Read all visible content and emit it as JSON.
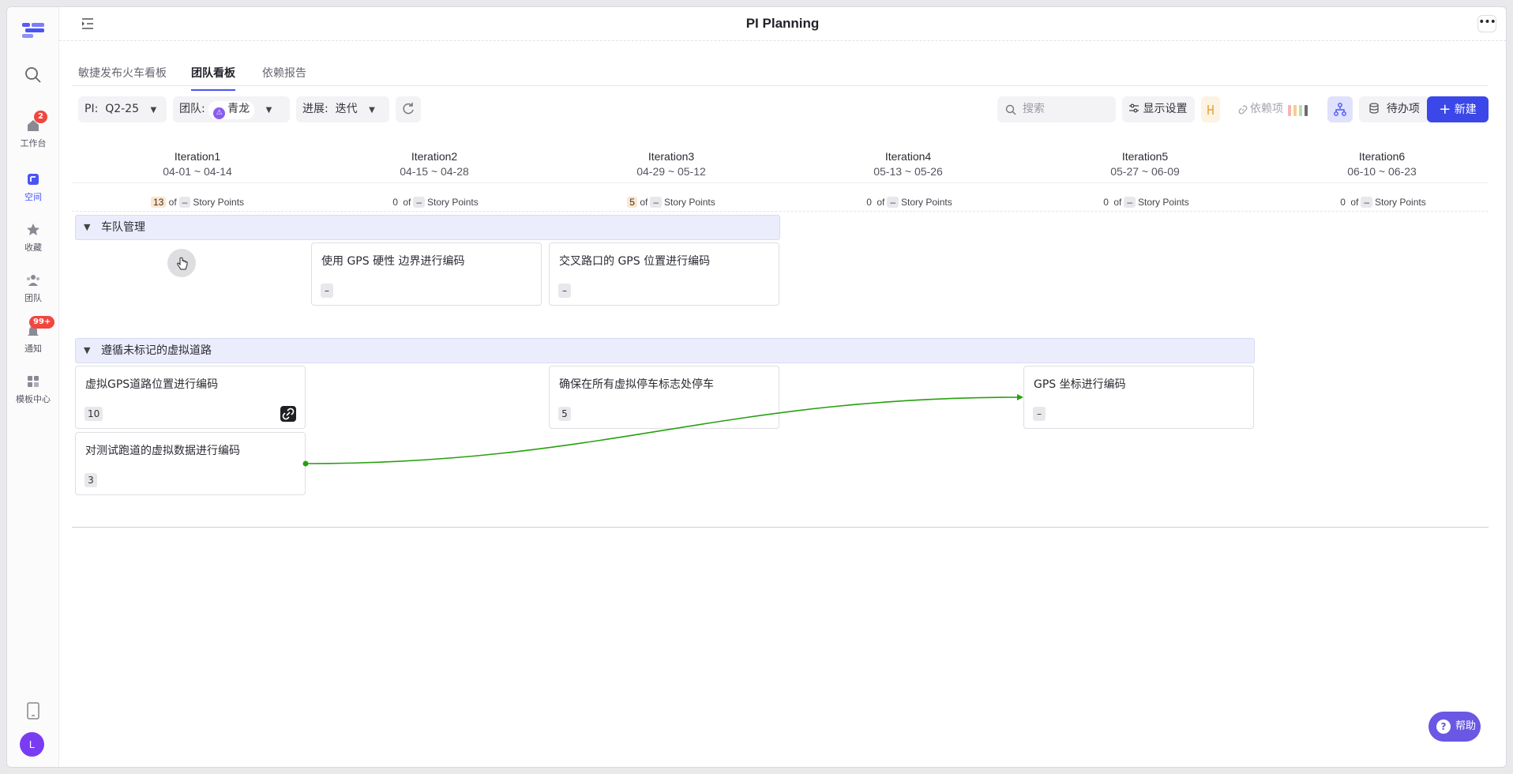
{
  "app": {
    "title": "PI Planning"
  },
  "sidebar": {
    "items": [
      {
        "label": "工作台",
        "badge": "2"
      },
      {
        "label": "空间"
      },
      {
        "label": "收藏"
      },
      {
        "label": "团队"
      },
      {
        "label": "通知",
        "badge": "99+"
      },
      {
        "label": "模板中心"
      }
    ],
    "avatar": "L"
  },
  "tabs": [
    "敏捷发布火车看板",
    "团队看板",
    "依赖报告"
  ],
  "toolbar": {
    "pi_label": "PI:",
    "pi_value": "Q2-25",
    "team_label": "团队:",
    "team_value": "青龙",
    "progress_label": "进展:",
    "progress_value": "迭代",
    "search_placeholder": "搜索",
    "display_settings": "显示设置",
    "dependencies": "依赖项",
    "backlog": "待办项",
    "new": "新建"
  },
  "iterations": [
    {
      "name": "Iteration1",
      "dates": "04-01 ~ 04-14",
      "points": "13",
      "of": "of",
      "cap": "–",
      "unit": "Story Points"
    },
    {
      "name": "Iteration2",
      "dates": "04-15 ~ 04-28",
      "points": "0",
      "of": "of",
      "cap": "–",
      "unit": "Story Points"
    },
    {
      "name": "Iteration3",
      "dates": "04-29 ~ 05-12",
      "points": "5",
      "of": "of",
      "cap": "–",
      "unit": "Story Points"
    },
    {
      "name": "Iteration4",
      "dates": "05-13 ~ 05-26",
      "points": "0",
      "of": "of",
      "cap": "–",
      "unit": "Story Points"
    },
    {
      "name": "Iteration5",
      "dates": "05-27 ~ 06-09",
      "points": "0",
      "of": "of",
      "cap": "–",
      "unit": "Story Points"
    },
    {
      "name": "Iteration6",
      "dates": "06-10 ~ 06-23",
      "points": "0",
      "of": "of",
      "cap": "–",
      "unit": "Story Points"
    }
  ],
  "groups": [
    {
      "name": "车队管理",
      "cards": [
        {
          "title": "使用 GPS 硬性 边界进行编码",
          "points": "–"
        },
        {
          "title": "交叉路口的 GPS 位置进行编码",
          "points": "–"
        }
      ]
    },
    {
      "name": "遵循未标记的虚拟道路",
      "cards": [
        {
          "title": "虚拟GPS道路位置进行编码",
          "points": "10"
        },
        {
          "title": "对测试跑道的虚拟数据进行编码",
          "points": "3"
        },
        {
          "title": "确保在所有虚拟停车标志处停车",
          "points": "5"
        },
        {
          "title": "GPS 坐标进行编码",
          "points": "–"
        }
      ]
    }
  ],
  "help": "帮助",
  "colors": {
    "accent": "#3b47e8",
    "dependency_line": "#28a010",
    "group_bg": "#ecedfc"
  },
  "icons": [
    "logo-icon",
    "search-icon",
    "home-icon",
    "space-icon",
    "star-icon",
    "team-icon",
    "bell-icon",
    "template-icon",
    "phone-icon",
    "sidebar-collapse-icon",
    "more-icon",
    "refresh-icon",
    "settings-sliders-icon",
    "link-icon",
    "hierarchy-icon",
    "stack-icon",
    "plus-icon",
    "help-icon"
  ]
}
